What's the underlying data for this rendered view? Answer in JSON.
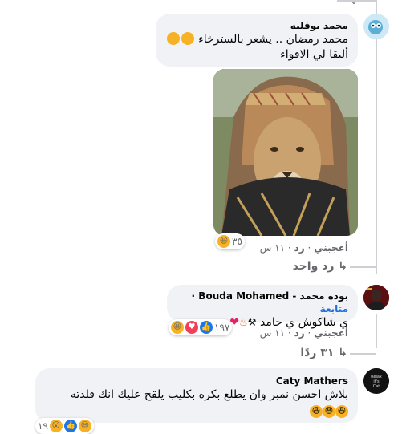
{
  "comments": [
    {
      "author": "محمد بوفليه",
      "line1": "محمد رمضان .. يشعر بالسترخاء",
      "line2": "ألبقا لي الاقواء",
      "like_label": "أعجبني",
      "reply_label": "رد",
      "time": "١١ س",
      "reaction_count": "٣٥",
      "replies_link": "رد واحد"
    },
    {
      "author": "بوده محمد - Bouda Mohamed",
      "follow_label": "متابعة",
      "text": "ي شاكوش ي جامد",
      "like_label": "أعجبني",
      "reply_label": "رد",
      "time": "١١ س",
      "reaction_count": "١٩٧",
      "replies_link": "٣١ ردًا"
    },
    {
      "author": "Caty Mathers",
      "text": "بلاش احسن نمبر وان يطلع بكره بكليب يلقح عليك انك قلدته",
      "reaction_count": "١٩"
    }
  ],
  "icons": {
    "reply_arrow": "reply-arrow-icon",
    "haha": "haha-reaction-icon",
    "love": "love-reaction-icon",
    "like": "like-reaction-icon",
    "wow": "wow-reaction-icon"
  },
  "colors": {
    "bubble": "#f0f2f5",
    "secondary_text": "#65676b",
    "link_blue": "#216fdb",
    "thread_line": "#ced0d4"
  }
}
